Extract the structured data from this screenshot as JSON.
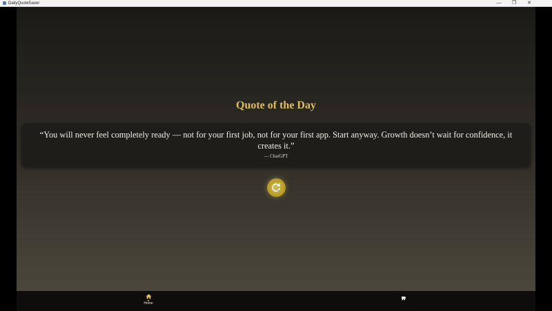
{
  "window": {
    "title": "DailyQuoteSaver",
    "controls": {
      "minimize": "—",
      "maximize": "❐",
      "close": "✕"
    }
  },
  "main": {
    "title": "Quote of the Day",
    "quote": {
      "text": "“You will never feel completely ready — not for your first job, not for your first app. Start anyway. Growth doesn’t wait for confidence, it creates it.”",
      "author": "— ChatGPT"
    },
    "refresh_button": {
      "icon": "refresh-icon"
    }
  },
  "bottom_nav": {
    "items": [
      {
        "label": "Home",
        "icon": "home-icon",
        "active": true
      },
      {
        "label": "",
        "icon": "quote-icon",
        "glyph": "❞",
        "active": false
      }
    ]
  },
  "colors": {
    "accent": "#e0bd62",
    "button": "#c8ac36",
    "card": "#1e1d1a",
    "nav_bg": "#0e0d0b"
  }
}
